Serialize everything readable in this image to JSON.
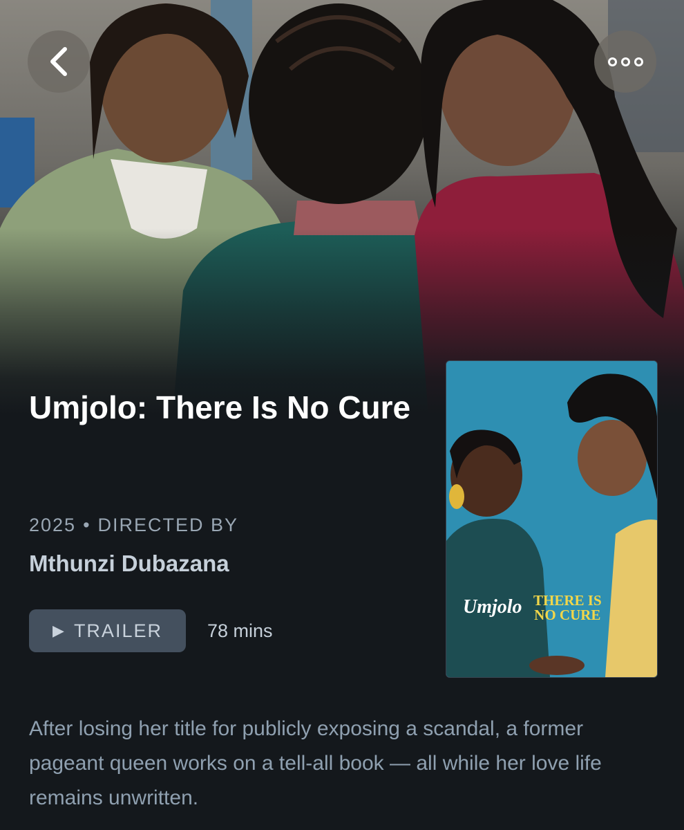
{
  "header": {
    "back_icon": "chevron-left-icon",
    "more_icon": "more-horizontal-icon"
  },
  "film": {
    "title": "Umjolo: There Is No Cure",
    "year": "2025",
    "separator": "•",
    "directed_by_label": "DIRECTED BY",
    "director": "Mthunzi Dubazana",
    "trailer_label": "TRAILER",
    "runtime": "78 mins",
    "synopsis": "After losing her title for publicly exposing a scandal, a former pageant queen works on a tell-all book — all while her love life remains unwritten."
  },
  "poster": {
    "brand": "Umjolo",
    "tagline_line1": "THERE IS",
    "tagline_line2": "NO CURE"
  },
  "colors": {
    "background": "#14181c",
    "button_bg": "#44505e",
    "tagline": "#f1d64a"
  }
}
